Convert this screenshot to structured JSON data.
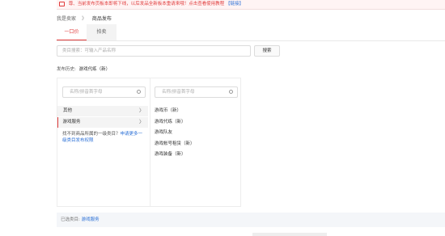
{
  "notice": {
    "text": "尊、当前发布页板本即将下线，以后发品全新板本重请来哦！点击查看使用教程",
    "link": "【链接】"
  },
  "breadcrumb": {
    "parent": "我是卖家",
    "separator": "》",
    "current": "商品发布"
  },
  "tabs": [
    {
      "label": "一口价",
      "active": true
    },
    {
      "label": "拍卖",
      "active": false
    }
  ],
  "search": {
    "placeholder": "类目搜索：可输入产品名称",
    "button": "搜索"
  },
  "history": {
    "label": "发布历史:",
    "item": "游戏代练（新）"
  },
  "category_column_1": {
    "search_placeholder": "名称/拼音首字母",
    "items": [
      {
        "label": "其他",
        "arrow": "〉"
      },
      {
        "label": "游戏服务",
        "arrow": "〉"
      }
    ],
    "hint_text": "找不到商品所属的一级类目？",
    "hint_link": "申请更多一级类目发布权限"
  },
  "category_column_2": {
    "search_placeholder": "名称/拼音首字母",
    "items": [
      "游戏币（新）",
      "游戏代练（新）",
      "游戏队友",
      "游戏帐号租赁（新）",
      "游戏装备（新）"
    ]
  },
  "selected": {
    "label": "已选类目:",
    "value": "游戏服务"
  },
  "colors": {
    "accent": "#e03b3b",
    "link": "#2a6fd6"
  }
}
